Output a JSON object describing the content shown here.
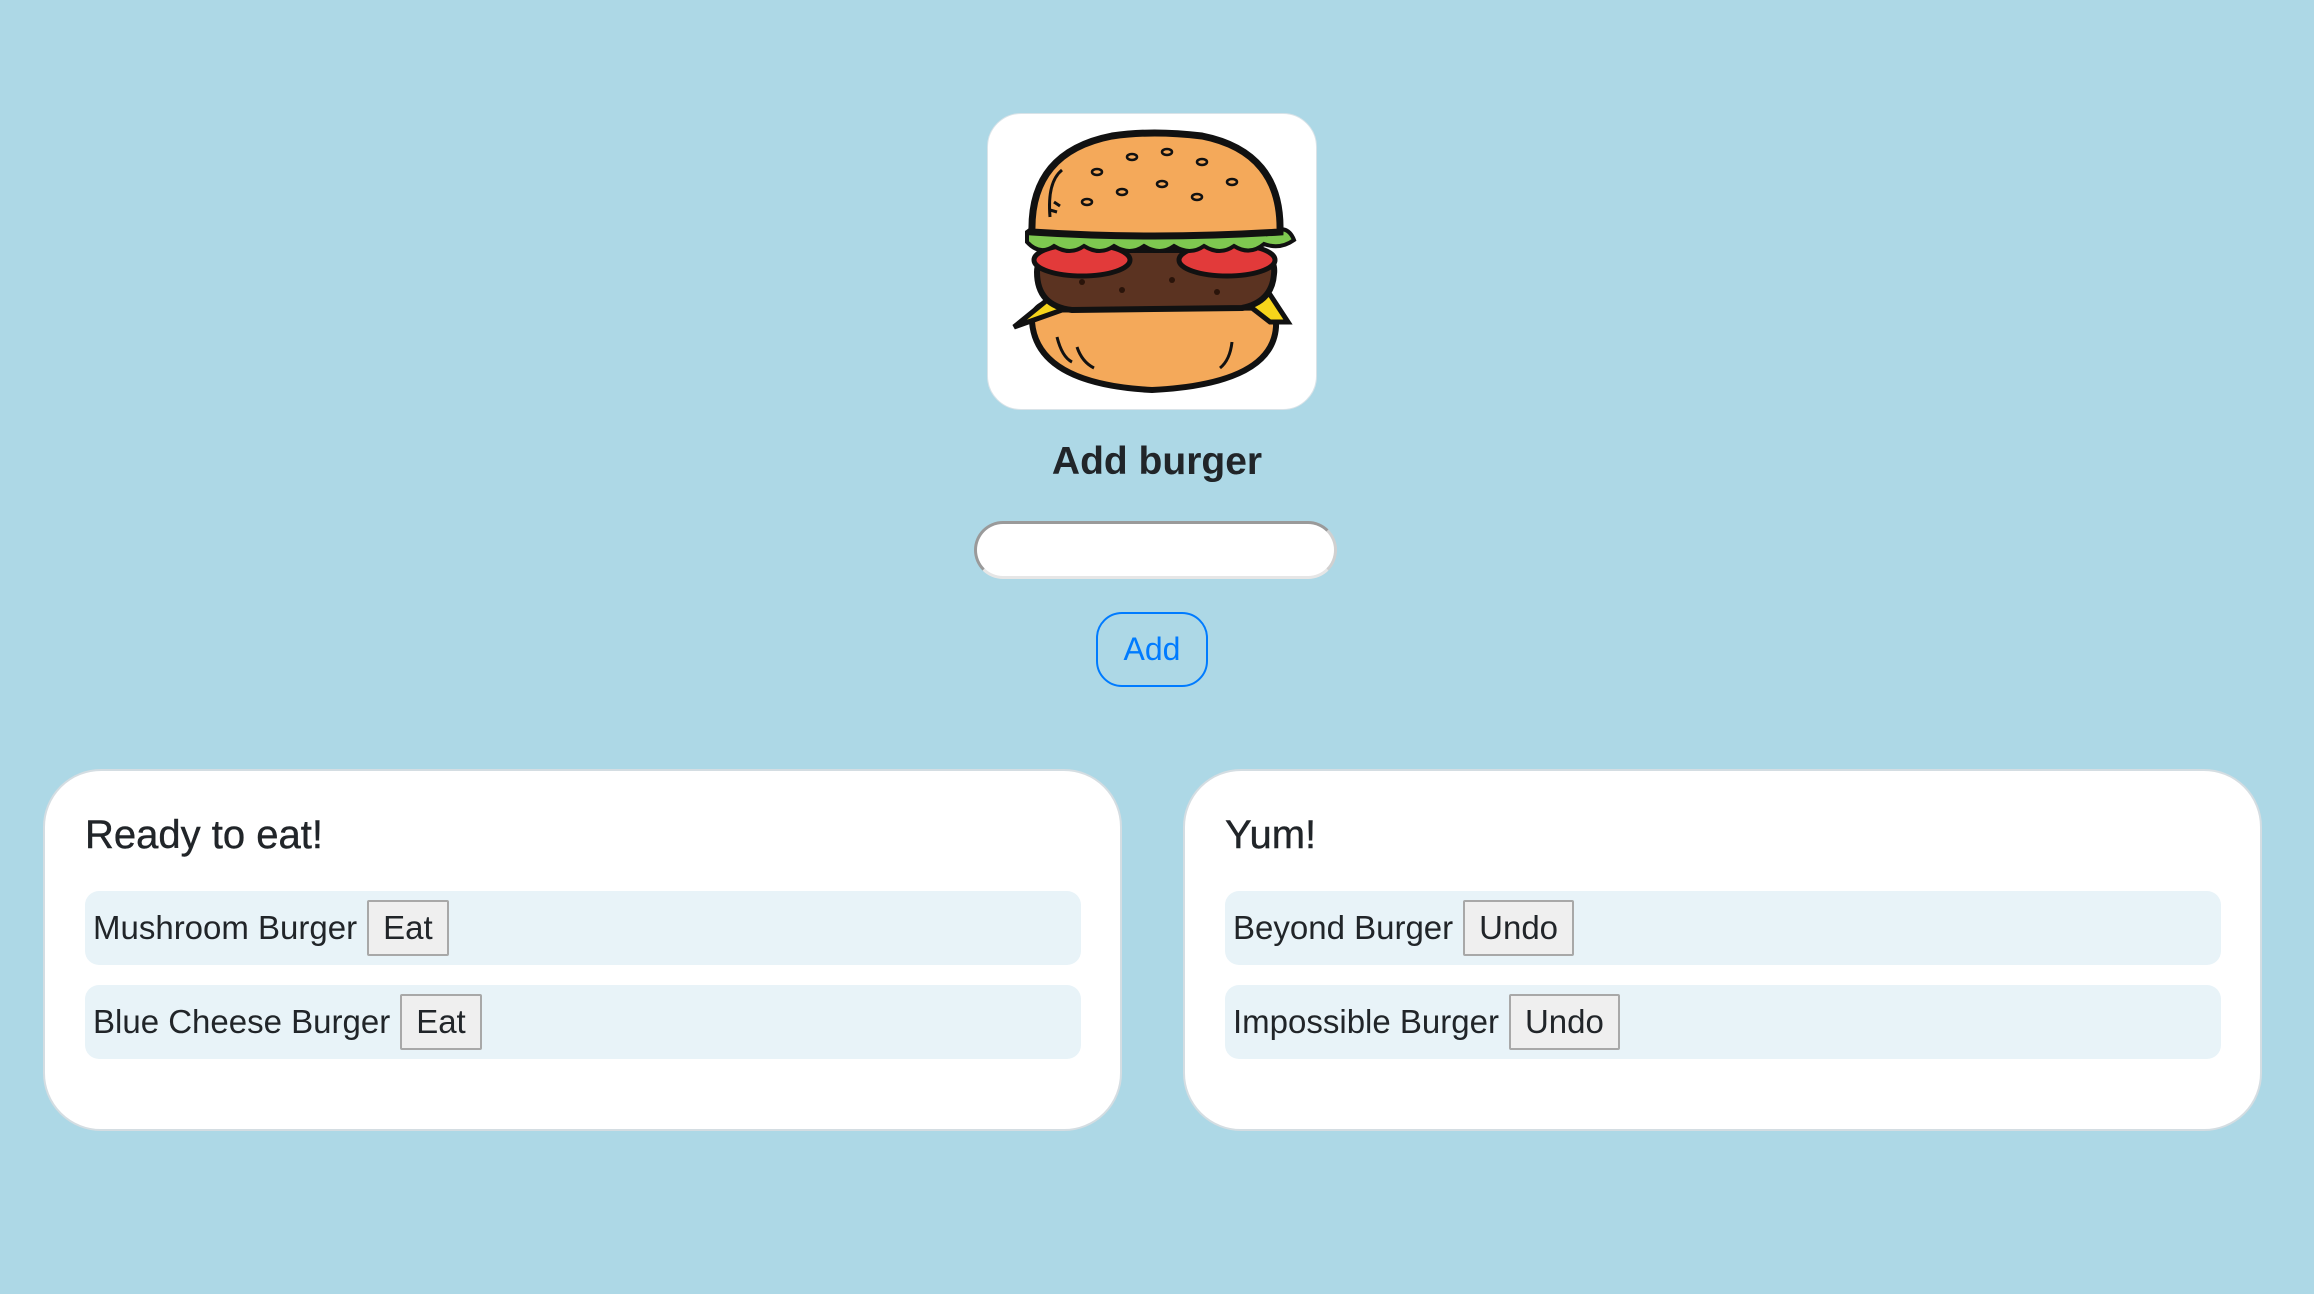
{
  "header": {
    "logo": "burger-icon",
    "title": "Add burger"
  },
  "form": {
    "input_value": "",
    "add_label": "Add"
  },
  "ready_panel": {
    "title": "Ready to eat!",
    "items": [
      {
        "name": "Mushroom Burger",
        "action": "Eat"
      },
      {
        "name": "Blue Cheese Burger",
        "action": "Eat"
      }
    ]
  },
  "eaten_panel": {
    "title": "Yum!",
    "items": [
      {
        "name": "Beyond Burger",
        "action": "Undo"
      },
      {
        "name": "Impossible Burger",
        "action": "Undo"
      }
    ]
  },
  "colors": {
    "background": "#add8e6",
    "accent": "#007bff",
    "item_background": "#e8f3f8"
  }
}
